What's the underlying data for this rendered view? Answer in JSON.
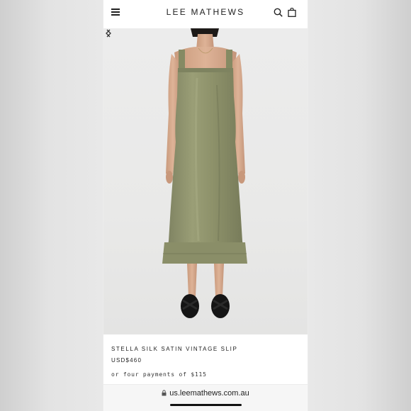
{
  "header": {
    "brand": "LEE MATHEWS",
    "menu_icon": "hamburger-icon",
    "search_icon": "search-icon",
    "bag_icon": "shopping-bag-icon"
  },
  "carousel": {
    "prev_icon": "chevron-left-icon",
    "next_icon": "chevron-right-icon"
  },
  "product": {
    "title": "STELLA SILK SATIN VINTAGE SLIP",
    "price": "USD$460",
    "installments": "or four payments of $115",
    "dress_color": "#8f936b"
  },
  "browser": {
    "url": "us.leemathews.com.au",
    "lock_icon": "lock-icon"
  }
}
